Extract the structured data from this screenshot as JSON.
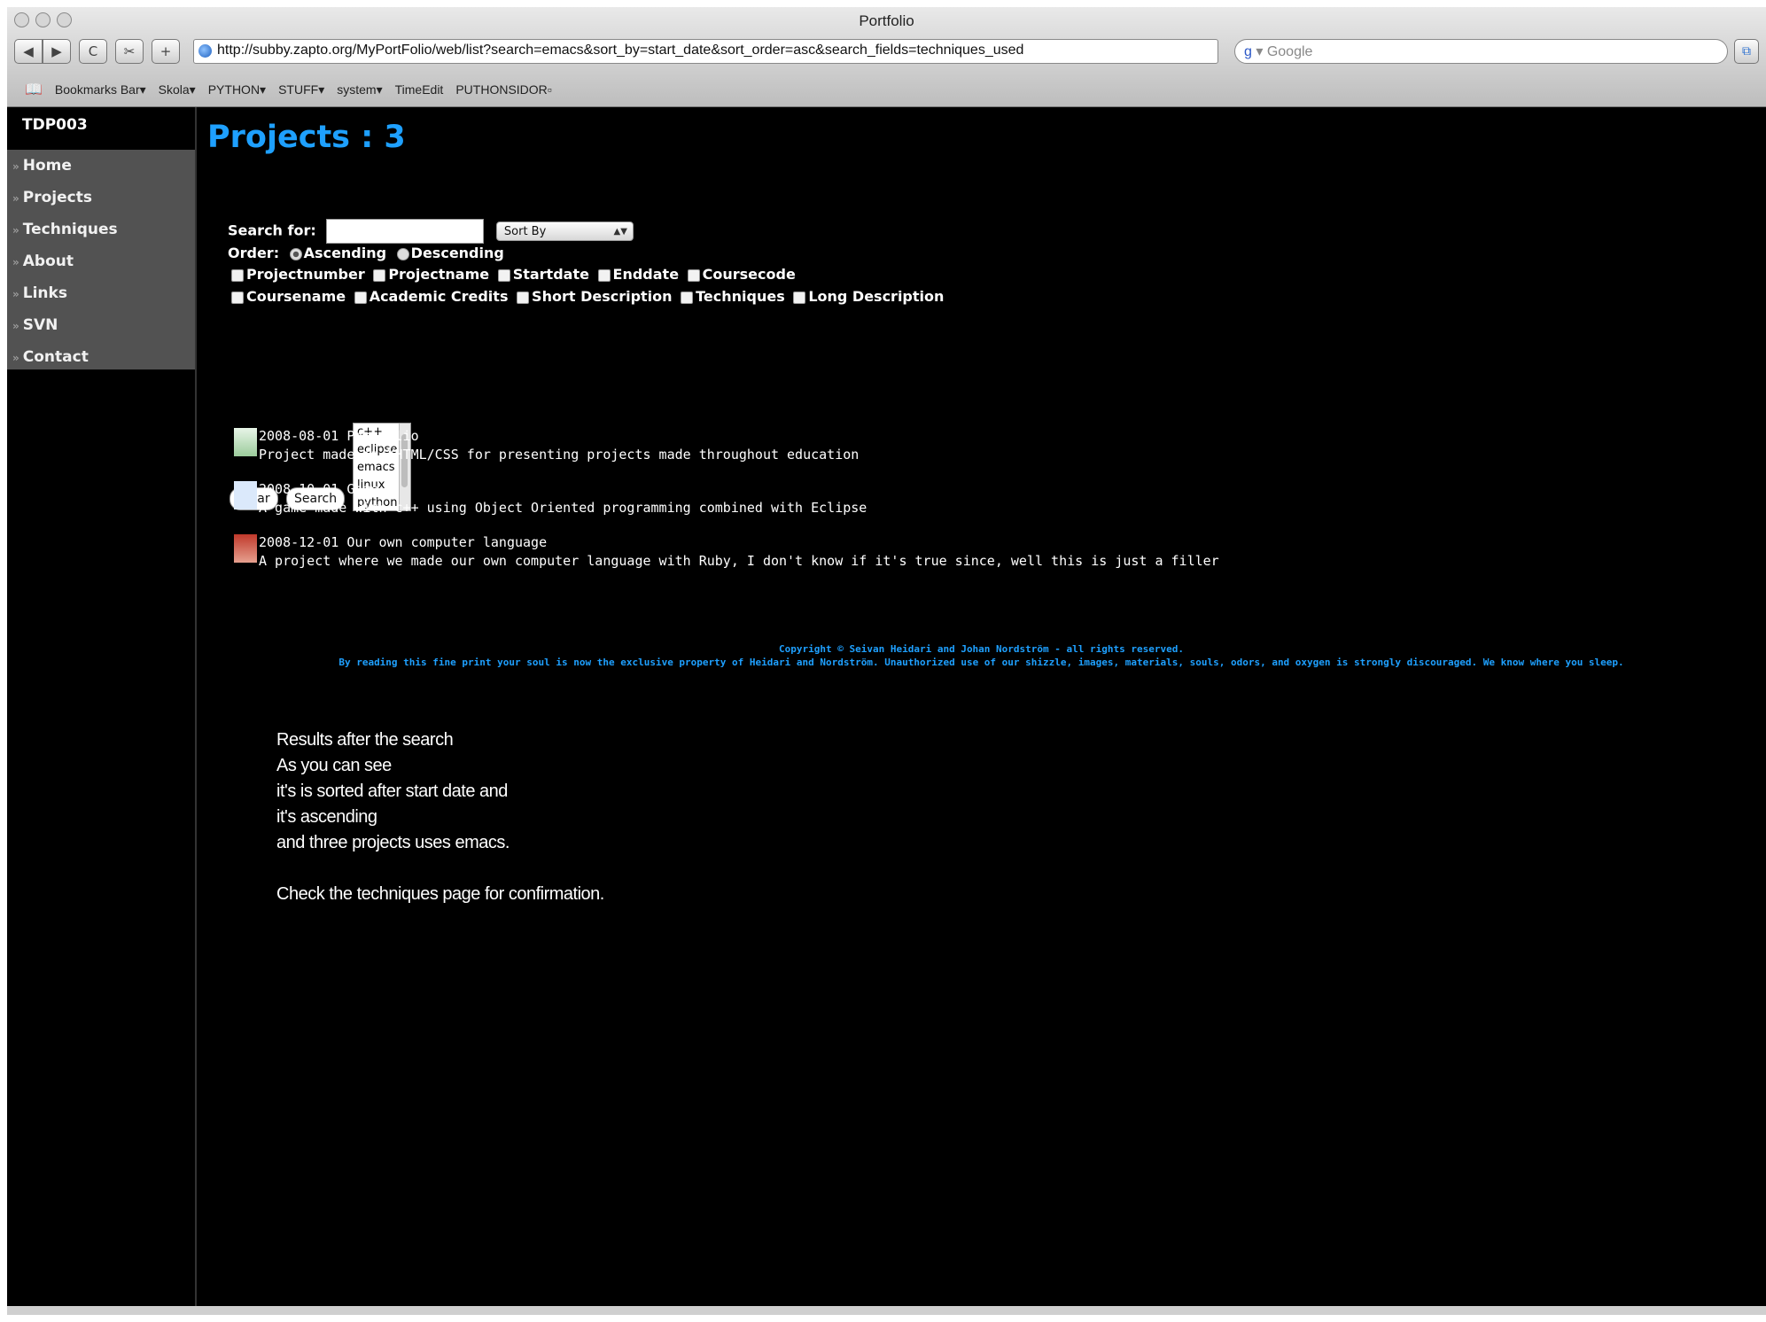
{
  "window": {
    "title": "Portfolio"
  },
  "toolbar": {
    "back_icon": "back-arrow-icon",
    "forward_icon": "forward-arrow-icon",
    "reload_label": "C",
    "add_label": "+",
    "url": "http://subby.zapto.org/MyPortFolio/web/list?search=emacs&sort_by=start_date&sort_order=asc&search_fields=techniques_used",
    "search_placeholder": "Google",
    "search_engine_glyph": "g"
  },
  "bookmarks": [
    "Bookmarks Bar▾",
    "Skola▾",
    "PYTHON▾",
    "STUFF▾",
    "system▾",
    "TimeEdit",
    "PUTHONSIDOR▫"
  ],
  "site": {
    "title": "TDP003",
    "menu": [
      "Home",
      "Projects",
      "Techniques",
      "About",
      "Links",
      "SVN",
      "Contact"
    ]
  },
  "page": {
    "heading": "Projects : 3",
    "search_label": "Search for:",
    "search_value": "",
    "sort_select": "Sort By",
    "order_label": "Order:",
    "order_options": [
      "Ascending",
      "Descending"
    ],
    "order_selected": "Ascending",
    "fields_row1": [
      "Projectnumber",
      "Projectname",
      "Startdate",
      "Enddate",
      "Coursecode"
    ],
    "fields_row2": [
      "Coursename",
      "Academic Credits",
      "Short Description",
      "Techniques",
      "Long Description"
    ],
    "techniques": [
      "c++",
      "eclipse",
      "emacs",
      "linux",
      "python"
    ],
    "clear_label": "Clear",
    "search_button_label": "Search"
  },
  "projects": [
    {
      "title": "2008-08-01 Portfolio",
      "desc": "Project made in XHTML/CSS for presenting projects made throughout education"
    },
    {
      "title": "2008-10-01 Game",
      "desc": "A game made with c++ using Object Oriented programming combined with Eclipse"
    },
    {
      "title": "2008-12-01 Our own computer language",
      "desc": "A project where we made our own computer language with Ruby, I don't know if it's true since, well this is just a filler"
    }
  ],
  "footer": {
    "line1": "Copyright © Seivan Heidari and Johan Nordström - all rights reserved.",
    "line2": "By reading this fine print your soul is now the exclusive property of Heidari and Nordström. Unauthorized use of our shizzle, images, materials, souls, odors, and oxygen is strongly discouraged. We know where you sleep."
  },
  "note": [
    "Results after the search",
    "As you can see",
    "it's is sorted after start date and",
    "it's ascending",
    "and three projects uses emacs.",
    "",
    "Check the techniques page for confirmation."
  ],
  "colors": {
    "accent": "#1ea0ff",
    "background": "#000000",
    "menu_bg": "#525252"
  }
}
